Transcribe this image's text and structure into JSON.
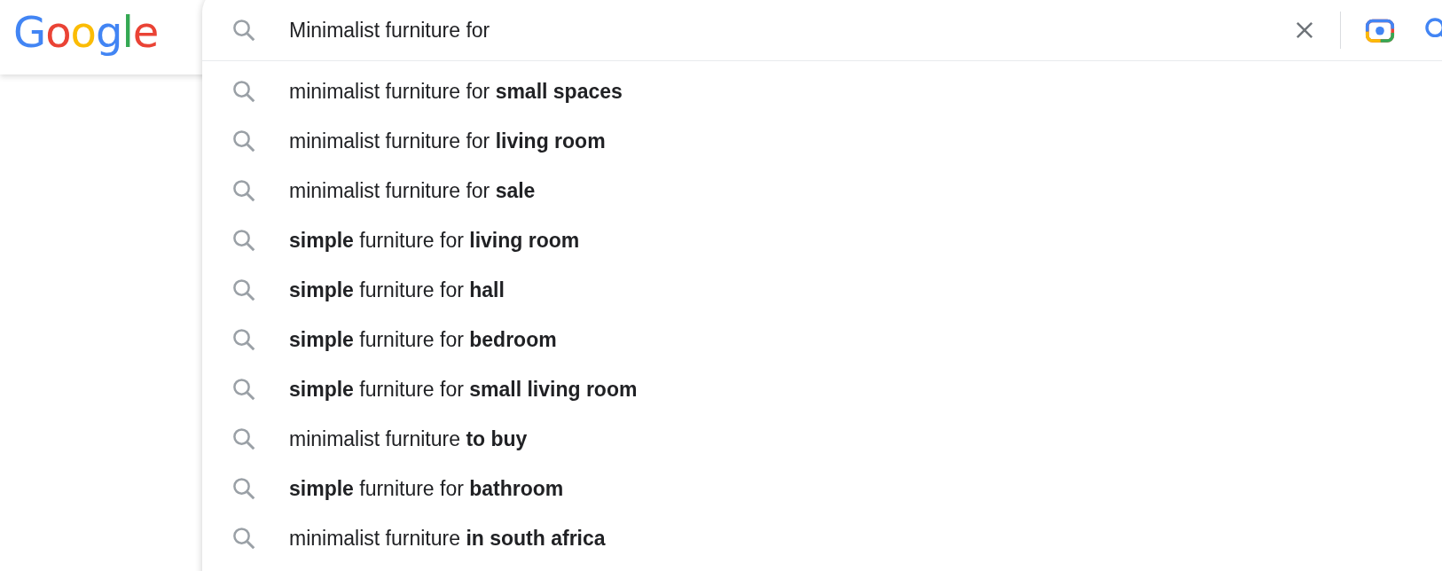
{
  "logo": {
    "text": "Google"
  },
  "search": {
    "value": "Minimalist furniture for "
  },
  "suggestions": [
    "minimalist furniture for **small spaces**",
    "minimalist furniture for **living room**",
    "minimalist furniture for **sale**",
    "**simple** furniture for **living room**",
    "**simple** furniture for **hall**",
    "**simple** furniture for **bedroom**",
    "**simple** furniture for **small living room**",
    "minimalist furniture **to buy**",
    "**simple** furniture for **bathroom**",
    "minimalist furniture **in south africa**"
  ]
}
